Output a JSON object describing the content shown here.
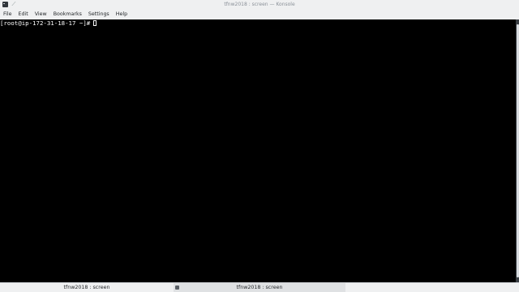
{
  "window": {
    "title": "tfnw2018 : screen — Konsole",
    "icons": [
      "konsole-app-icon",
      "pin-icon"
    ]
  },
  "menubar": {
    "items": [
      {
        "label": "File"
      },
      {
        "label": "Edit"
      },
      {
        "label": "View"
      },
      {
        "label": "Bookmarks"
      },
      {
        "label": "Settings"
      },
      {
        "label": "Help"
      }
    ]
  },
  "terminal": {
    "prompt": "[root@ip-172-31-18-17 ~]#",
    "background": "#000000",
    "foreground": "#fcfcfc"
  },
  "tabs": [
    {
      "label": "tfnw2018 : screen",
      "active": false
    },
    {
      "label": "tfnw2018 : screen",
      "active": true
    }
  ]
}
